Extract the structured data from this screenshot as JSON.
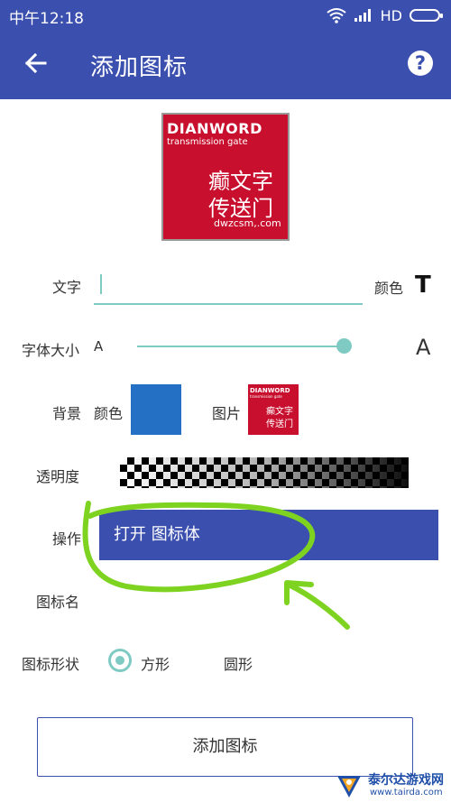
{
  "status_bar": {
    "time": "中午12:18",
    "network": "HD"
  },
  "app_bar": {
    "title": "添加图标",
    "back_icon": "arrow-left-icon",
    "help_icon": "help-circle-icon",
    "help_glyph": "?"
  },
  "preview": {
    "brand": "DIANWORD",
    "tagline": "transmission gate",
    "line1": "癫文字",
    "line2": "传送门",
    "url": "dwzcsm,.com",
    "background_color": "#c8102e"
  },
  "form": {
    "text_label": "文字",
    "text_value": "",
    "color_label": "颜色",
    "color_icon_glyph": "T",
    "font_size_label": "字体大小",
    "font_size_small": "A",
    "font_size_large": "A",
    "font_size_level": 0.95,
    "background_label": "背景",
    "bg_color_label": "颜色",
    "bg_color": "#2370c4",
    "bg_image_label": "图片",
    "transparency_label": "透明度",
    "action_label": "操作",
    "open_button": "打开 图标体",
    "icon_name_label": "图标名",
    "shape_label": "图标形状",
    "shape_options": [
      "方形",
      "圆形"
    ],
    "shape_selected": "方形",
    "add_button": "添加图标"
  },
  "colors": {
    "primary": "#3a4fae",
    "accent": "#7fcbc4",
    "annotation": "#7ed321"
  },
  "watermark": {
    "name": "泰尔达游戏网",
    "url": "www.tairda.com"
  }
}
